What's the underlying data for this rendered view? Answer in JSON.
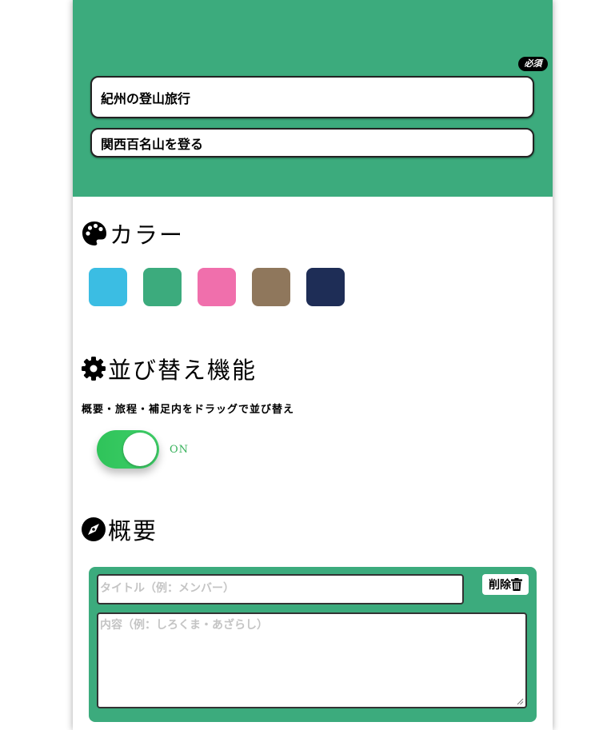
{
  "header": {
    "required_badge": "必須",
    "trip_title": "紀州の登山旅行",
    "trip_subtitle": "関西百名山を登る"
  },
  "color_section": {
    "heading": "カラー",
    "icon": "palette-icon",
    "swatches": [
      "#3bbde3",
      "#3cab7d",
      "#f06fac",
      "#8f775c",
      "#1e2d56"
    ]
  },
  "sort_section": {
    "heading": "並び替え機能",
    "icon": "gear-icon",
    "description": "概要・旅程・補足内をドラッグで並び替え",
    "toggle_state": "ON"
  },
  "overview_section": {
    "heading": "概要",
    "icon": "compass-icon",
    "item": {
      "title_placeholder": "タイトル（例：メンバー）",
      "body_placeholder": "内容（例：しろくま・あざらし）",
      "delete_label": "削除"
    }
  },
  "colors": {
    "accent": "#3cab7d",
    "toggle_on": "#2fc35a"
  }
}
